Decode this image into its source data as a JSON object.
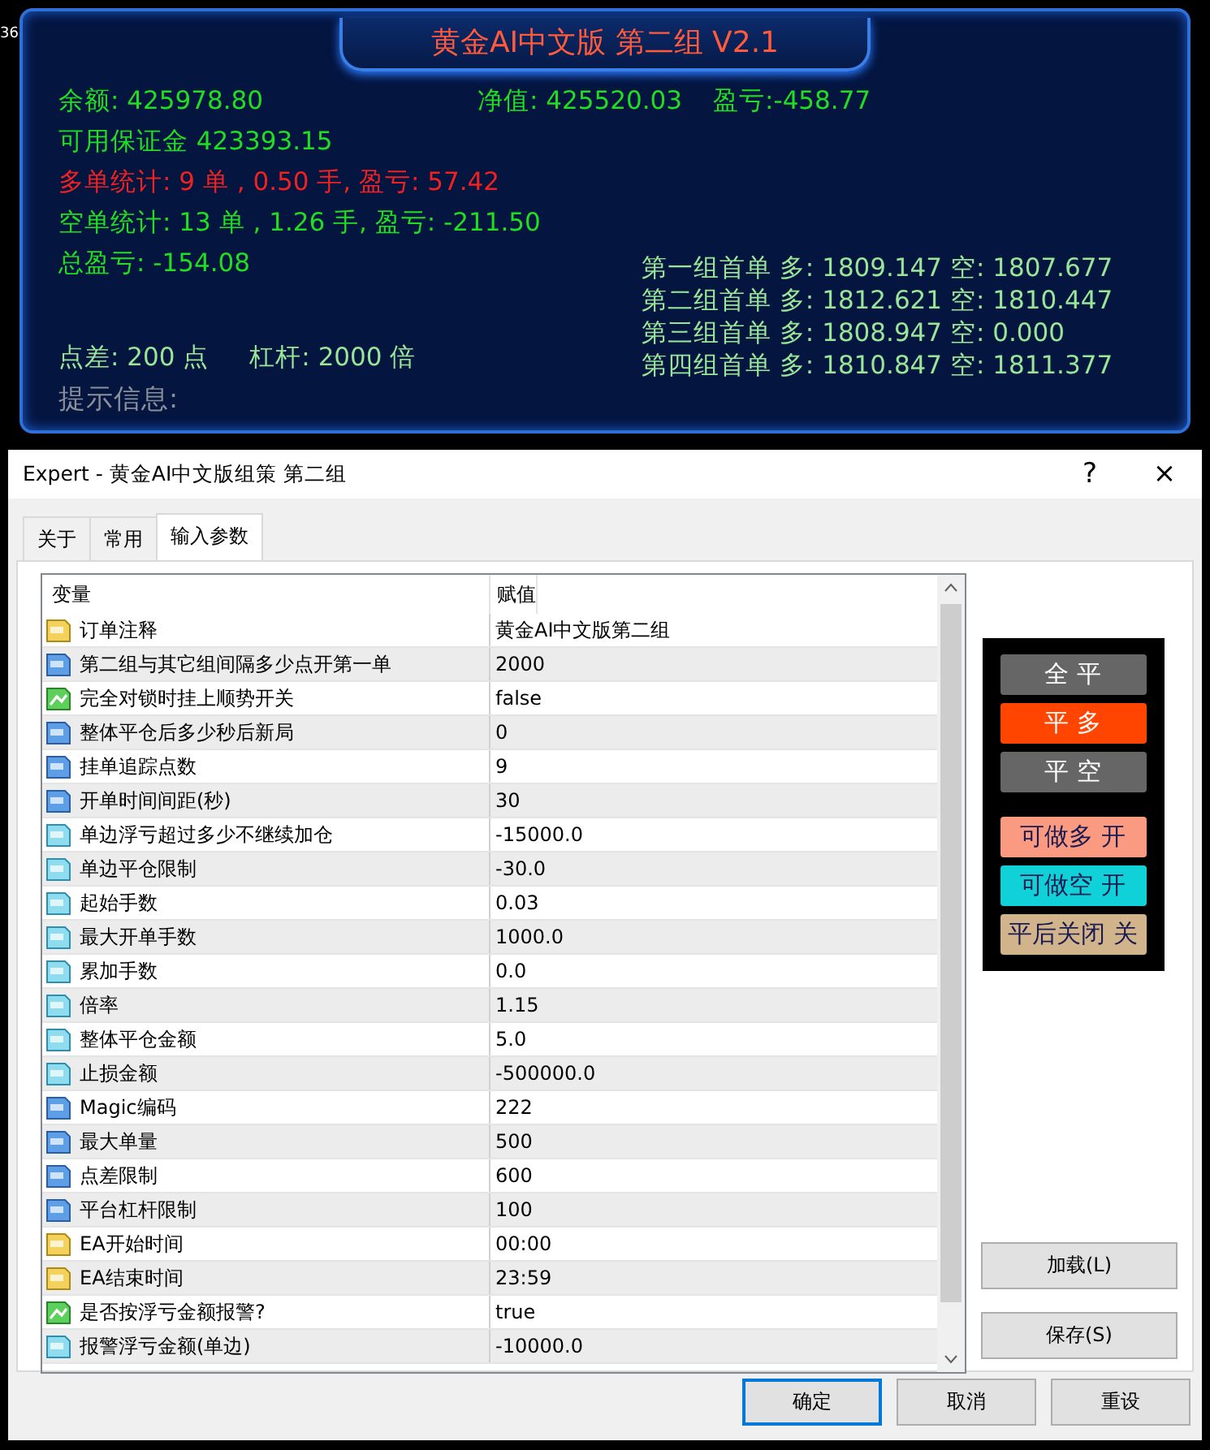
{
  "edge_label": "36",
  "panel": {
    "title": "黄金AI中文版 第二组 V2.1",
    "top_row": [
      {
        "text": "余额: 425978.80",
        "color": "#22dd22"
      },
      {
        "text": "净值: 425520.03",
        "color": "#22dd22"
      },
      {
        "text": "盈亏:-458.77",
        "color": "#22dd22"
      }
    ],
    "lines": [
      {
        "text": "可用保证金 423393.15",
        "color": "#22dd22"
      },
      {
        "text": "多单统计: 9 单 , 0.50 手,  盈亏: 57.42",
        "color": "#ee2222"
      },
      {
        "text": "空单统计: 13 单 , 1.26 手,  盈亏: -211.50",
        "color": "#22dd22"
      },
      {
        "text": "总盈亏: -154.08",
        "color": "#22dd22"
      }
    ],
    "spread": {
      "text": "点差: 200 点",
      "color": "#99e699"
    },
    "leverage": {
      "text": "杠杆: 2000 倍",
      "color": "#99e699"
    },
    "hint": {
      "text": "提示信息:",
      "color": "#8a8f9a"
    },
    "first_orders": [
      "第一组首单 多: 1809.147 空: 1807.677",
      "第二组首单 多: 1812.621 空: 1810.447",
      "第三组首单 多: 1808.947 空: 0.000",
      "第四组首单 多: 1810.847 空: 1811.377"
    ]
  },
  "dialog": {
    "title": "Expert - 黄金AI中文版组策 第二组",
    "help": "?",
    "close": "×",
    "tabs": [
      {
        "label": "关于",
        "selected": false
      },
      {
        "label": "常用",
        "selected": false
      },
      {
        "label": "输入参数",
        "selected": true
      }
    ],
    "table": {
      "columns": [
        "变量",
        "赋值"
      ],
      "rows": [
        {
          "kind": "string",
          "name": "订单注释",
          "value": "黄金AI中文版第二组"
        },
        {
          "kind": "int",
          "name": "第二组与其它组间隔多少点开第一单",
          "value": "2000"
        },
        {
          "kind": "bool",
          "name": "完全对锁时挂上顺势开关",
          "value": "false"
        },
        {
          "kind": "int",
          "name": "整体平仓后多少秒后新局",
          "value": "0"
        },
        {
          "kind": "int",
          "name": "挂单追踪点数",
          "value": "9"
        },
        {
          "kind": "int",
          "name": "开单时间间距(秒)",
          "value": "30"
        },
        {
          "kind": "double",
          "name": "单边浮亏超过多少不继续加仓",
          "value": "-15000.0"
        },
        {
          "kind": "double",
          "name": "单边平仓限制",
          "value": "-30.0"
        },
        {
          "kind": "double",
          "name": "起始手数",
          "value": "0.03"
        },
        {
          "kind": "double",
          "name": "最大开单手数",
          "value": "1000.0"
        },
        {
          "kind": "double",
          "name": "累加手数",
          "value": "0.0"
        },
        {
          "kind": "double",
          "name": "倍率",
          "value": "1.15"
        },
        {
          "kind": "double",
          "name": "整体平仓金额",
          "value": "5.0"
        },
        {
          "kind": "double",
          "name": "止损金额",
          "value": "-500000.0"
        },
        {
          "kind": "int",
          "name": "Magic编码",
          "value": "222"
        },
        {
          "kind": "int",
          "name": "最大单量",
          "value": "500"
        },
        {
          "kind": "int",
          "name": "点差限制",
          "value": "600"
        },
        {
          "kind": "int",
          "name": "平台杠杆限制",
          "value": "100"
        },
        {
          "kind": "string",
          "name": "EA开始时间",
          "value": "00:00"
        },
        {
          "kind": "string",
          "name": "EA结束时间",
          "value": "23:59"
        },
        {
          "kind": "bool",
          "name": "是否按浮亏金额报警?",
          "value": "true"
        },
        {
          "kind": "double",
          "name": "报警浮亏金额(单边)",
          "value": "-10000.0"
        }
      ]
    },
    "panel_buttons": [
      {
        "label": "全 平",
        "color": "#666666"
      },
      {
        "label": "平 多",
        "color": "#ff4500"
      },
      {
        "label": "平 空",
        "color": "#666666"
      },
      {
        "label": "可做多 开",
        "color": "#fa9a80"
      },
      {
        "label": "可做空 开",
        "color": "#10d0d8"
      },
      {
        "label": "平后关闭 关",
        "color": "#d2b48c"
      }
    ],
    "side_buttons": [
      "加载(L)",
      "保存(S)"
    ],
    "footer_buttons": [
      {
        "label": "确定",
        "selected": true
      },
      {
        "label": "取消",
        "selected": false
      },
      {
        "label": "重设",
        "selected": false
      }
    ]
  }
}
